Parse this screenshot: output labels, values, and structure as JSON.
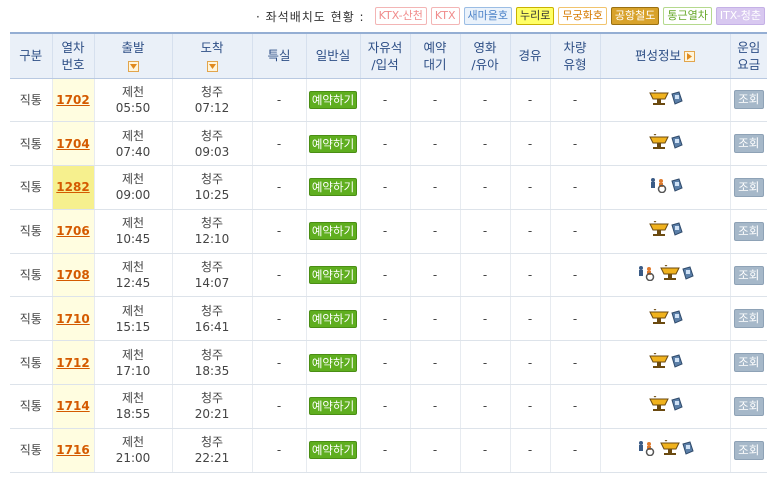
{
  "legend": {
    "title": "· 좌석배치도 현황 :",
    "items": [
      {
        "label": "KTX-산천",
        "color": "#f08c8c",
        "bg": "#ffffff",
        "border": "#f3b5b5"
      },
      {
        "label": "KTX",
        "color": "#f08c8c",
        "bg": "#ffffff",
        "border": "#f3b5b5"
      },
      {
        "label": "새마을호",
        "color": "#4f84c9",
        "bg": "#eaf2fb",
        "border": "#9bbde4"
      },
      {
        "label": "누리로",
        "color": "#333333",
        "bg": "#ffff66",
        "border": "#c9b200"
      },
      {
        "label": "무궁화호",
        "color": "#d67a00",
        "bg": "#ffffff",
        "border": "#f1c46e"
      },
      {
        "label": "공항철도",
        "color": "#ffffff",
        "bg": "#d8a22b",
        "border": "#9a7010"
      },
      {
        "label": "통근열차",
        "color": "#67a82a",
        "bg": "#ffffff",
        "border": "#b5d98e"
      },
      {
        "label": "ITX-청춘",
        "color": "#ffffff",
        "bg": "#d8c8f0",
        "border": "#c5b1e6"
      }
    ]
  },
  "headers": {
    "type": "구분",
    "train_no_1": "열차",
    "train_no_2": "번호",
    "departure": "출발",
    "arrival": "도착",
    "special": "특실",
    "general": "일반실",
    "free_seat_1": "자유석",
    "free_seat_2": "/입석",
    "waitlist_1": "예약",
    "waitlist_2": "대기",
    "movie_1": "영화",
    "movie_2": "/유아",
    "via": "경유",
    "vehicle_1": "차량",
    "vehicle_2": "유형",
    "formation": "편성정보",
    "fare_1": "운임",
    "fare_2": "요금"
  },
  "rows": [
    {
      "type": "직통",
      "train_no": "1702",
      "dep_station": "제천",
      "dep_time": "05:50",
      "arr_station": "청주",
      "arr_time": "07:12",
      "special": "-",
      "general": "예약하기",
      "free_seat": "-",
      "waitlist": "-",
      "movie": "-",
      "via": "-",
      "vehicle": "-",
      "formation_icons": [
        "cafe-icon",
        "phone-icon"
      ],
      "fare": "조회",
      "highlight": false
    },
    {
      "type": "직통",
      "train_no": "1704",
      "dep_station": "제천",
      "dep_time": "07:40",
      "arr_station": "청주",
      "arr_time": "09:03",
      "special": "-",
      "general": "예약하기",
      "free_seat": "-",
      "waitlist": "-",
      "movie": "-",
      "via": "-",
      "vehicle": "-",
      "formation_icons": [
        "cafe-icon",
        "phone-icon"
      ],
      "fare": "조회",
      "highlight": false
    },
    {
      "type": "직통",
      "train_no": "1282",
      "dep_station": "제천",
      "dep_time": "09:00",
      "arr_station": "청주",
      "arr_time": "10:25",
      "special": "-",
      "general": "예약하기",
      "free_seat": "-",
      "waitlist": "-",
      "movie": "-",
      "via": "-",
      "vehicle": "-",
      "formation_icons": [
        "wheelchair-icon",
        "phone-icon"
      ],
      "fare": "조회",
      "highlight": true
    },
    {
      "type": "직통",
      "train_no": "1706",
      "dep_station": "제천",
      "dep_time": "10:45",
      "arr_station": "청주",
      "arr_time": "12:10",
      "special": "-",
      "general": "예약하기",
      "free_seat": "-",
      "waitlist": "-",
      "movie": "-",
      "via": "-",
      "vehicle": "-",
      "formation_icons": [
        "cafe-icon",
        "phone-icon"
      ],
      "fare": "조회",
      "highlight": false
    },
    {
      "type": "직통",
      "train_no": "1708",
      "dep_station": "제천",
      "dep_time": "12:45",
      "arr_station": "청주",
      "arr_time": "14:07",
      "special": "-",
      "general": "예약하기",
      "free_seat": "-",
      "waitlist": "-",
      "movie": "-",
      "via": "-",
      "vehicle": "-",
      "formation_icons": [
        "wheelchair-icon",
        "cafe-icon",
        "phone-icon"
      ],
      "fare": "조회",
      "highlight": false
    },
    {
      "type": "직통",
      "train_no": "1710",
      "dep_station": "제천",
      "dep_time": "15:15",
      "arr_station": "청주",
      "arr_time": "16:41",
      "special": "-",
      "general": "예약하기",
      "free_seat": "-",
      "waitlist": "-",
      "movie": "-",
      "via": "-",
      "vehicle": "-",
      "formation_icons": [
        "cafe-icon",
        "phone-icon"
      ],
      "fare": "조회",
      "highlight": false
    },
    {
      "type": "직통",
      "train_no": "1712",
      "dep_station": "제천",
      "dep_time": "17:10",
      "arr_station": "청주",
      "arr_time": "18:35",
      "special": "-",
      "general": "예약하기",
      "free_seat": "-",
      "waitlist": "-",
      "movie": "-",
      "via": "-",
      "vehicle": "-",
      "formation_icons": [
        "cafe-icon",
        "phone-icon"
      ],
      "fare": "조회",
      "highlight": false
    },
    {
      "type": "직통",
      "train_no": "1714",
      "dep_station": "제천",
      "dep_time": "18:55",
      "arr_station": "청주",
      "arr_time": "20:21",
      "special": "-",
      "general": "예약하기",
      "free_seat": "-",
      "waitlist": "-",
      "movie": "-",
      "via": "-",
      "vehicle": "-",
      "formation_icons": [
        "cafe-icon",
        "phone-icon"
      ],
      "fare": "조회",
      "highlight": false
    },
    {
      "type": "직통",
      "train_no": "1716",
      "dep_station": "제천",
      "dep_time": "21:00",
      "arr_station": "청주",
      "arr_time": "22:21",
      "special": "-",
      "general": "예약하기",
      "free_seat": "-",
      "waitlist": "-",
      "movie": "-",
      "via": "-",
      "vehicle": "-",
      "formation_icons": [
        "wheelchair-icon",
        "cafe-icon",
        "phone-icon"
      ],
      "fare": "조회",
      "highlight": false
    }
  ]
}
